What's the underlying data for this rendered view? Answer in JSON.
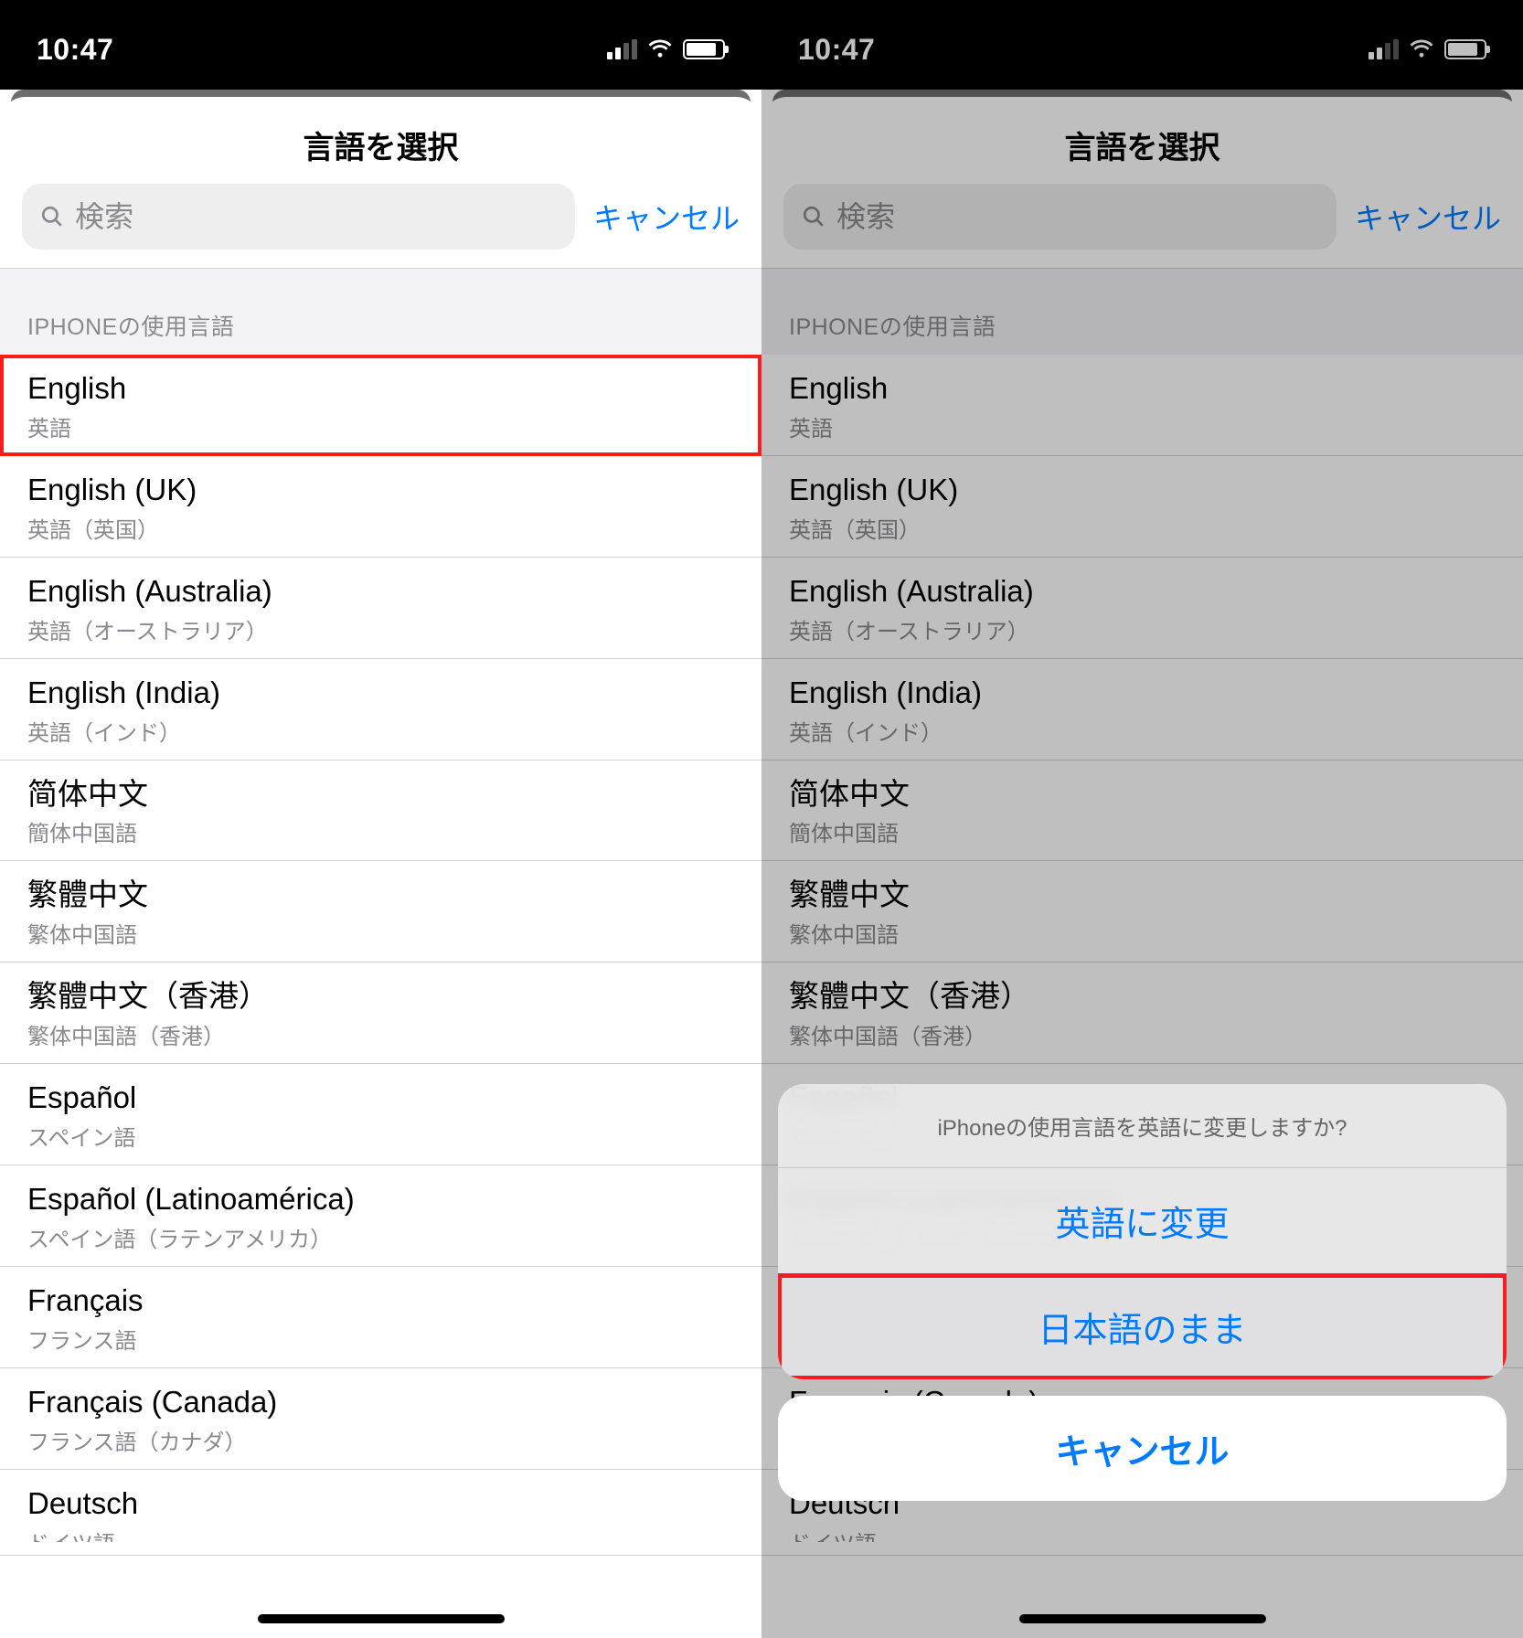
{
  "status": {
    "time": "10:47"
  },
  "sheet": {
    "title": "言語を選択",
    "search_placeholder": "検索",
    "cancel": "キャンセル",
    "section_title": "IPHONEの使用言語"
  },
  "languages": [
    {
      "primary": "English",
      "secondary": "英語"
    },
    {
      "primary": "English (UK)",
      "secondary": "英語（英国）"
    },
    {
      "primary": "English (Australia)",
      "secondary": "英語（オーストラリア）"
    },
    {
      "primary": "English (India)",
      "secondary": "英語（インド）"
    },
    {
      "primary": "简体中文",
      "secondary": "簡体中国語"
    },
    {
      "primary": "繁體中文",
      "secondary": "繁体中国語"
    },
    {
      "primary": "繁體中文（香港）",
      "secondary": "繁体中国語（香港）"
    },
    {
      "primary": "Español",
      "secondary": "スペイン語"
    },
    {
      "primary": "Español (Latinoamérica)",
      "secondary": "スペイン語（ラテンアメリカ）"
    },
    {
      "primary": "Français",
      "secondary": "フランス語"
    },
    {
      "primary": "Français (Canada)",
      "secondary": "フランス語（カナダ）"
    },
    {
      "primary": "Deutsch",
      "secondary": "ドイツ語"
    }
  ],
  "action_sheet": {
    "message": "iPhoneの使用言語を英語に変更しますか?",
    "change": "英語に変更",
    "keep": "日本語のまま",
    "cancel": "キャンセル"
  }
}
